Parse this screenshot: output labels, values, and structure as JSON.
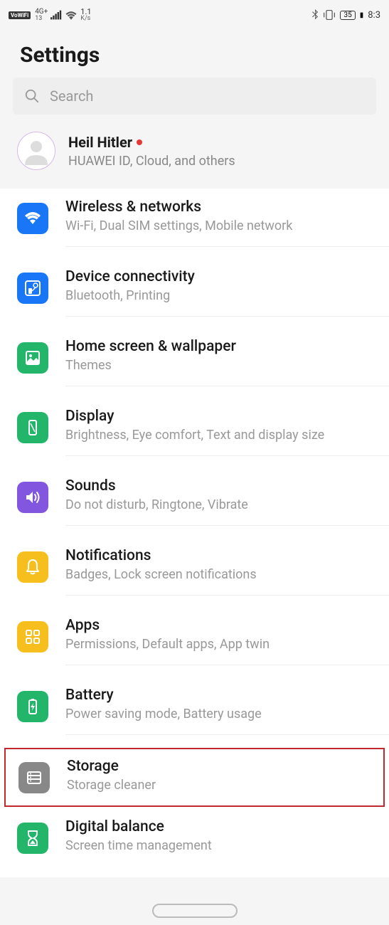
{
  "status": {
    "vowifi": "VoWiFi",
    "network_gen": "4G+",
    "network_sub": "13",
    "speed_num": "1.1",
    "speed_unit": "K/s",
    "battery": "35",
    "time": "8:3"
  },
  "page": {
    "title": "Settings",
    "search_placeholder": "Search"
  },
  "account": {
    "name": "Heil Hitler",
    "sub": "HUAWEI ID, Cloud, and others"
  },
  "items": [
    {
      "title": "Wireless & networks",
      "sub": "Wi-Fi, Dual SIM settings, Mobile network",
      "color": "ic-blue",
      "icon": "wifi"
    },
    {
      "title": "Device connectivity",
      "sub": "Bluetooth, Printing",
      "color": "ic-blue",
      "icon": "connect"
    },
    {
      "title": "Home screen & wallpaper",
      "sub": "Themes",
      "color": "ic-green",
      "icon": "wallpaper"
    },
    {
      "title": "Display",
      "sub": "Brightness, Eye comfort, Text and display size",
      "color": "ic-green",
      "icon": "display"
    },
    {
      "title": "Sounds",
      "sub": "Do not disturb, Ringtone, Vibrate",
      "color": "ic-purple",
      "icon": "sound"
    },
    {
      "title": "Notifications",
      "sub": "Badges, Lock screen notifications",
      "color": "ic-amber",
      "icon": "bell"
    },
    {
      "title": "Apps",
      "sub": "Permissions, Default apps, App twin",
      "color": "ic-amber",
      "icon": "apps"
    },
    {
      "title": "Battery",
      "sub": "Power saving mode, Battery usage",
      "color": "ic-green",
      "icon": "battery"
    },
    {
      "title": "Storage",
      "sub": "Storage cleaner",
      "color": "ic-gray",
      "icon": "storage",
      "highlighted": true
    },
    {
      "title": "Digital balance",
      "sub": "Screen time management",
      "color": "ic-green",
      "icon": "balance"
    }
  ]
}
